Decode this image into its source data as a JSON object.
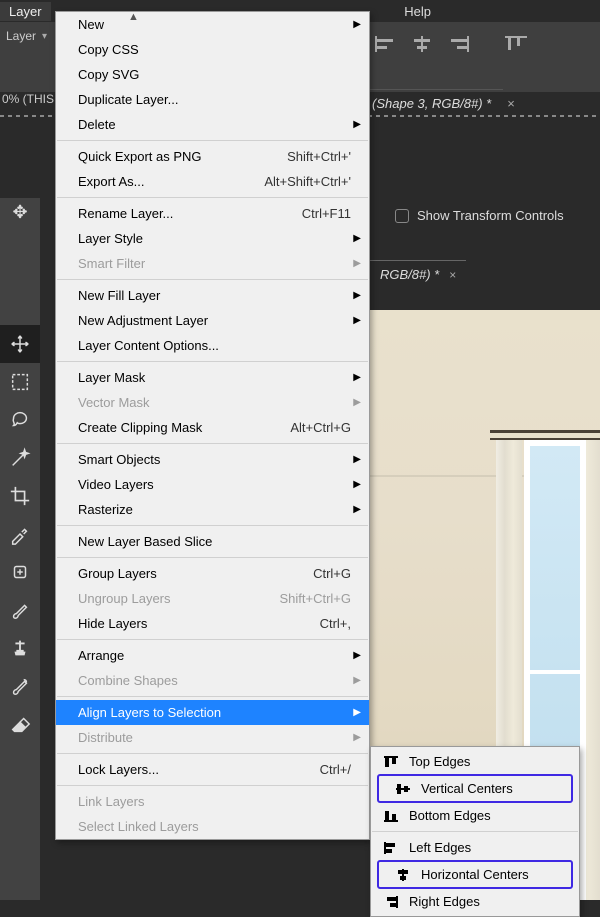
{
  "menubar": {
    "layer": "Layer",
    "help": "Help",
    "sub_layer_label": "Layer"
  },
  "percent_label": "0% (THIS",
  "transform_label": "Show Transform Controls",
  "doc_tab1": "(Shape 3, RGB/8#) *",
  "file_tab": "RGB/8#) *",
  "menu": {
    "items": [
      {
        "label": "New",
        "sub": true
      },
      {
        "label": "Copy CSS"
      },
      {
        "label": "Copy SVG"
      },
      {
        "label": "Duplicate Layer..."
      },
      {
        "label": "Delete",
        "sub": true
      },
      {
        "sep": true
      },
      {
        "label": "Quick Export as PNG",
        "short": "Shift+Ctrl+'"
      },
      {
        "label": "Export As...",
        "short": "Alt+Shift+Ctrl+'"
      },
      {
        "sep": true
      },
      {
        "label": "Rename Layer...",
        "short": "Ctrl+F11"
      },
      {
        "label": "Layer Style",
        "sub": true
      },
      {
        "label": "Smart Filter",
        "sub": true,
        "disabled": true
      },
      {
        "sep": true
      },
      {
        "label": "New Fill Layer",
        "sub": true
      },
      {
        "label": "New Adjustment Layer",
        "sub": true
      },
      {
        "label": "Layer Content Options..."
      },
      {
        "sep": true
      },
      {
        "label": "Layer Mask",
        "sub": true
      },
      {
        "label": "Vector Mask",
        "sub": true,
        "disabled": true
      },
      {
        "label": "Create Clipping Mask",
        "short": "Alt+Ctrl+G"
      },
      {
        "sep": true
      },
      {
        "label": "Smart Objects",
        "sub": true
      },
      {
        "label": "Video Layers",
        "sub": true
      },
      {
        "label": "Rasterize",
        "sub": true
      },
      {
        "sep": true
      },
      {
        "label": "New Layer Based Slice"
      },
      {
        "sep": true
      },
      {
        "label": "Group Layers",
        "short": "Ctrl+G"
      },
      {
        "label": "Ungroup Layers",
        "short": "Shift+Ctrl+G",
        "disabled": true
      },
      {
        "label": "Hide Layers",
        "short": "Ctrl+,"
      },
      {
        "sep": true
      },
      {
        "label": "Arrange",
        "sub": true
      },
      {
        "label": "Combine Shapes",
        "sub": true,
        "disabled": true
      },
      {
        "sep": true
      },
      {
        "label": "Align Layers to Selection",
        "sub": true,
        "highlight": true
      },
      {
        "label": "Distribute",
        "sub": true,
        "disabled": true
      },
      {
        "sep": true
      },
      {
        "label": "Lock Layers...",
        "short": "Ctrl+/"
      },
      {
        "sep": true
      },
      {
        "label": "Link Layers",
        "disabled": true
      },
      {
        "label": "Select Linked Layers",
        "disabled": true
      }
    ]
  },
  "submenu": {
    "items": [
      {
        "label": "Top Edges",
        "icon": "a-top"
      },
      {
        "label": "Vertical Centers",
        "icon": "a-vc",
        "ring": true
      },
      {
        "label": "Bottom Edges",
        "icon": "a-bot"
      },
      {
        "sep": true
      },
      {
        "label": "Left Edges",
        "icon": "a-l"
      },
      {
        "label": "Horizontal Centers",
        "icon": "a-hc",
        "ring": true
      },
      {
        "label": "Right Edges",
        "icon": "a-r"
      }
    ]
  }
}
